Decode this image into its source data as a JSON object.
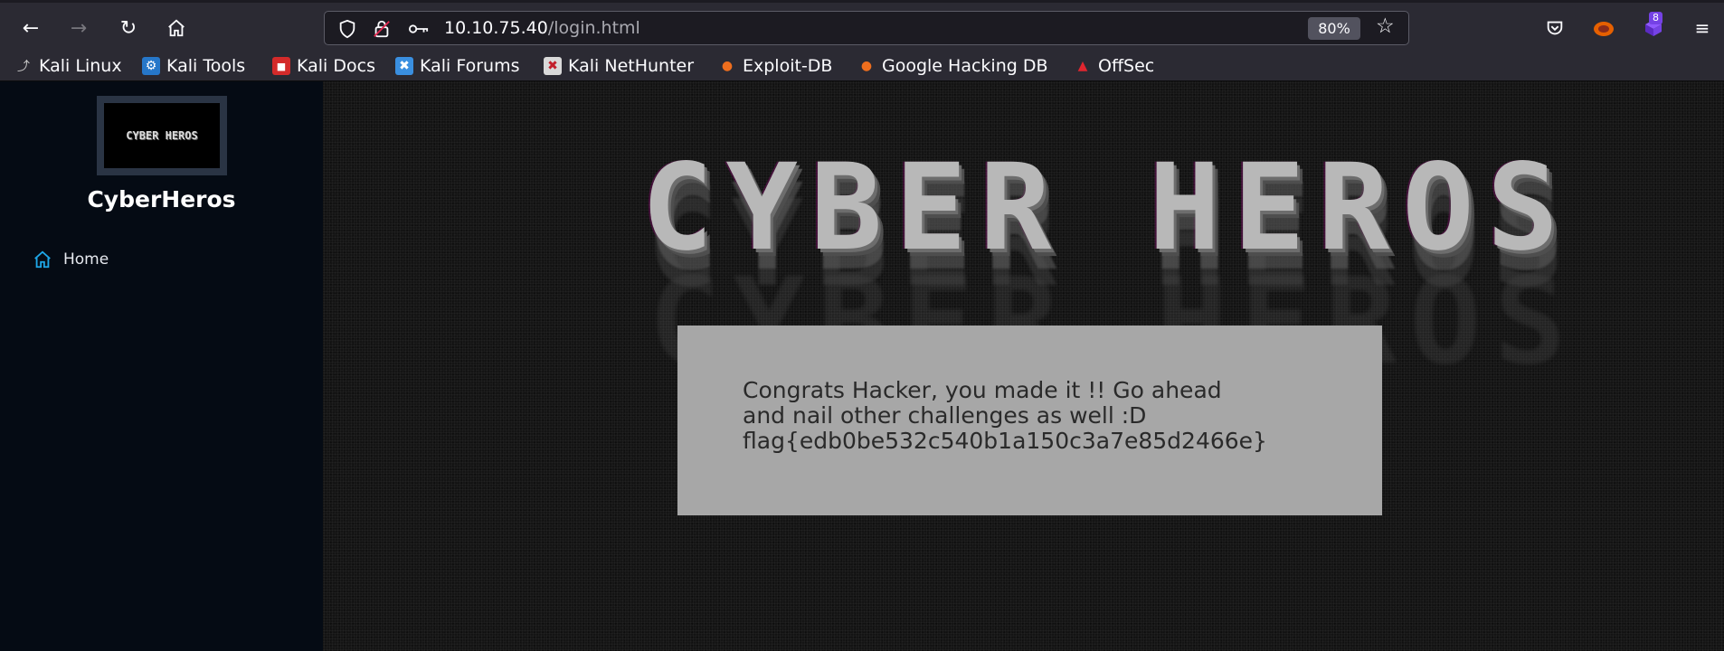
{
  "browser": {
    "url_host": "10.10.75.40",
    "url_path": "/login.html",
    "zoom": "80%",
    "extension_badge": "8"
  },
  "bookmarks": [
    {
      "label": "Kali Linux",
      "icon": "kali-dragon-icon"
    },
    {
      "label": "Kali Tools",
      "icon": "kali-tools-icon"
    },
    {
      "label": "Kali Docs",
      "icon": "kali-docs-icon"
    },
    {
      "label": "Kali Forums",
      "icon": "kali-forums-icon"
    },
    {
      "label": "Kali NetHunter",
      "icon": "kali-nethunter-icon"
    },
    {
      "label": "Exploit-DB",
      "icon": "exploit-db-icon"
    },
    {
      "label": "Google Hacking DB",
      "icon": "ghdb-icon"
    },
    {
      "label": "OffSec",
      "icon": "offsec-icon"
    }
  ],
  "sidebar": {
    "logo_text": "CYBER HEROS",
    "site_title": "CyberHeros",
    "nav": [
      {
        "label": "Home",
        "icon": "home-icon"
      }
    ]
  },
  "main": {
    "banner_text": "CYBER HEROS",
    "message_line1": "Congrats Hacker, you made it !! Go ahead",
    "message_line2": "and nail other challenges as well :D",
    "flag": "flag{edb0be532c540b1a150c3a7e85d2466e}"
  },
  "colors": {
    "sidebar_bg": "#050b14",
    "main_bg": "#141414",
    "message_box_bg": "#a7a7a7",
    "home_icon": "#1ea7e8"
  }
}
